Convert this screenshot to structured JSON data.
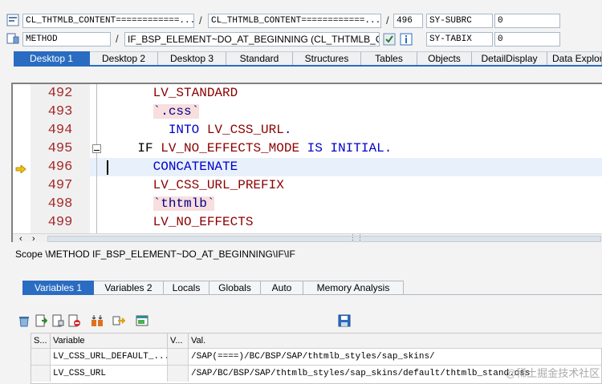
{
  "header": {
    "row1": {
      "program_field": "CL_THTMLB_CONTENT============...",
      "sep1": "/",
      "include_field": "CL_THTMLB_CONTENT============...",
      "sep2": "/",
      "line_field": "496",
      "sysfield1_label": "SY-SUBRC",
      "sysfield1_value": "0"
    },
    "row2": {
      "event_type": "METHOD",
      "sep": "/",
      "event_name": "IF_BSP_ELEMENT~DO_AT_BEGINNING (CL_THTMLB_C...",
      "sysfield2_label": "SY-TABIX",
      "sysfield2_value": "0"
    }
  },
  "main_tabs": [
    "Desktop 1",
    "Desktop 2",
    "Desktop 3",
    "Standard",
    "Structures",
    "Tables",
    "Objects",
    "DetailDisplay",
    "Data Explorer"
  ],
  "active_main_tab": 0,
  "code": {
    "line_numbers": [
      "492",
      "493",
      "494",
      "495",
      "496",
      "497",
      "498",
      "499"
    ],
    "current_line": "496",
    "lines": [
      [
        {
          "t": "      ",
          "c": "kw-dark"
        },
        {
          "t": "LV_STANDARD",
          "c": "var"
        }
      ],
      [
        {
          "t": "      ",
          "c": "kw-dark"
        },
        {
          "t": "`.css`",
          "c": "lit"
        }
      ],
      [
        {
          "t": "        ",
          "c": "kw-dark"
        },
        {
          "t": "INTO",
          "c": "kw-blue"
        },
        {
          "t": " ",
          "c": "kw-dark"
        },
        {
          "t": "LV_CSS_URL",
          "c": "var"
        },
        {
          "t": ".",
          "c": "kw-blue"
        }
      ],
      [
        {
          "t": "    ",
          "c": "kw-dark"
        },
        {
          "t": "IF",
          "c": "kw-dark"
        },
        {
          "t": " ",
          "c": "kw-dark"
        },
        {
          "t": "LV_NO_EFFECTS_MODE",
          "c": "var"
        },
        {
          "t": " ",
          "c": "kw-dark"
        },
        {
          "t": "IS",
          "c": "kw-blue"
        },
        {
          "t": " ",
          "c": "kw-dark"
        },
        {
          "t": "INITIAL",
          "c": "kw-blue"
        },
        {
          "t": ".",
          "c": "kw-blue"
        }
      ],
      [
        {
          "t": "      ",
          "c": "kw-dark"
        },
        {
          "t": "CONCATENATE",
          "c": "kw-blue"
        }
      ],
      [
        {
          "t": "      ",
          "c": "kw-dark"
        },
        {
          "t": "LV_CSS_URL_PREFIX",
          "c": "var"
        }
      ],
      [
        {
          "t": "      ",
          "c": "kw-dark"
        },
        {
          "t": "`thtmlb`",
          "c": "lit"
        }
      ],
      [
        {
          "t": "      ",
          "c": "kw-dark"
        },
        {
          "t": "LV_NO_EFFECTS",
          "c": "var"
        }
      ]
    ]
  },
  "scope": "Scope \\METHOD IF_BSP_ELEMENT~DO_AT_BEGINNING\\IF\\IF",
  "sub_tabs": [
    "Variables 1",
    "Variables 2",
    "Locals",
    "Globals",
    "Auto",
    "Memory Analysis"
  ],
  "active_sub_tab": 0,
  "grid": {
    "headers": [
      "S...",
      "Variable",
      "V...",
      "Val."
    ],
    "rows": [
      [
        "",
        "LV_CSS_URL_DEFAULT_...",
        "",
        "/SAP(====)/BC/BSP/SAP/thtmlb_styles/sap_skins/"
      ],
      [
        "",
        "LV_CSS_URL",
        "",
        "/SAP/BC/BSP/SAP/thtmlb_styles/sap_skins/default/thtmlb_stand.css"
      ]
    ]
  },
  "watermark": "@稀土掘金技术社区",
  "colors": {
    "accent": "#2a6cc1",
    "line_number": "#a52a2a",
    "keyword": "#0000cd",
    "variable": "#8b0000",
    "literal_bg": "#f9dede",
    "current_line_bg": "#e8f0fb"
  },
  "icons": [
    "program-icon",
    "event-icon",
    "choose-icon",
    "info-icon",
    "current-line-arrow-icon",
    "fold-collapse-icon",
    "scroll-left-icon",
    "scroll-right-icon",
    "delete-all-icon",
    "insert-variable-icon",
    "detail-icon",
    "delete-variable-icon",
    "sort-icon",
    "transfer-icon",
    "layout-icon",
    "save-icon"
  ]
}
